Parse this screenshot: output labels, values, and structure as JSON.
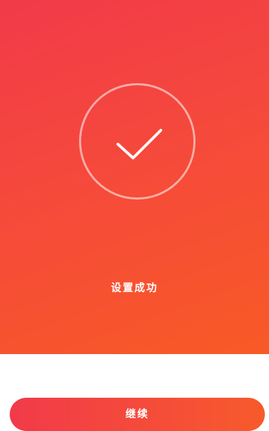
{
  "result": {
    "icon": "checkmark-icon",
    "status_text": "设置成功"
  },
  "actions": {
    "continue_label": "继续"
  },
  "colors": {
    "gradient_start": "#f23a49",
    "gradient_end": "#f85a26",
    "text": "#ffffff",
    "background": "#ffffff"
  }
}
